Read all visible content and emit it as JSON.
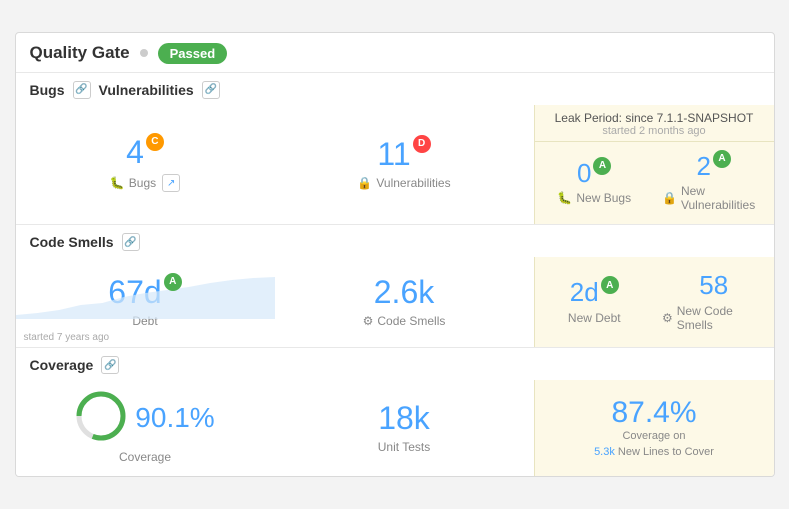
{
  "header": {
    "title": "Quality Gate",
    "status": "Passed"
  },
  "leak_period": {
    "title": "Leak Period: since 7.1.1-SNAPSHOT",
    "subtitle": "started 2 months ago"
  },
  "sections": {
    "bugs": {
      "label": "Bugs",
      "vuln_label": "Vulnerabilities",
      "metrics": {
        "bugs_value": "4",
        "bugs_rating": "C",
        "bugs_label": "Bugs",
        "vuln_value": "11",
        "vuln_rating": "D",
        "vuln_label": "Vulnerabilities"
      },
      "new_metrics": {
        "new_bugs_value": "0",
        "new_bugs_rating": "A",
        "new_bugs_label": "New Bugs",
        "new_vuln_value": "2",
        "new_vuln_rating": "A",
        "new_vuln_label": "New Vulnerabilities"
      }
    },
    "code_smells": {
      "label": "Code Smells",
      "metrics": {
        "debt_value": "67d",
        "debt_rating": "A",
        "debt_label": "Debt",
        "smells_value": "2.6k",
        "smells_label": "Code Smells",
        "note": "started 7 years ago"
      },
      "new_metrics": {
        "new_debt_value": "2d",
        "new_debt_rating": "A",
        "new_debt_label": "New Debt",
        "new_smells_value": "58",
        "new_smells_label": "New Code Smells"
      }
    },
    "coverage": {
      "label": "Coverage",
      "metrics": {
        "coverage_value": "90.1%",
        "coverage_label": "Coverage",
        "tests_value": "18k",
        "tests_label": "Unit Tests"
      },
      "new_metrics": {
        "new_coverage_value": "87.4%",
        "new_coverage_label": "Coverage on",
        "new_lines_value": "5.3k",
        "new_lines_label": "New Lines to Cover"
      }
    }
  },
  "icons": {
    "link": "🔗",
    "bug": "🐛",
    "lock": "🔒",
    "gear": "⚙",
    "trend": "↗"
  }
}
